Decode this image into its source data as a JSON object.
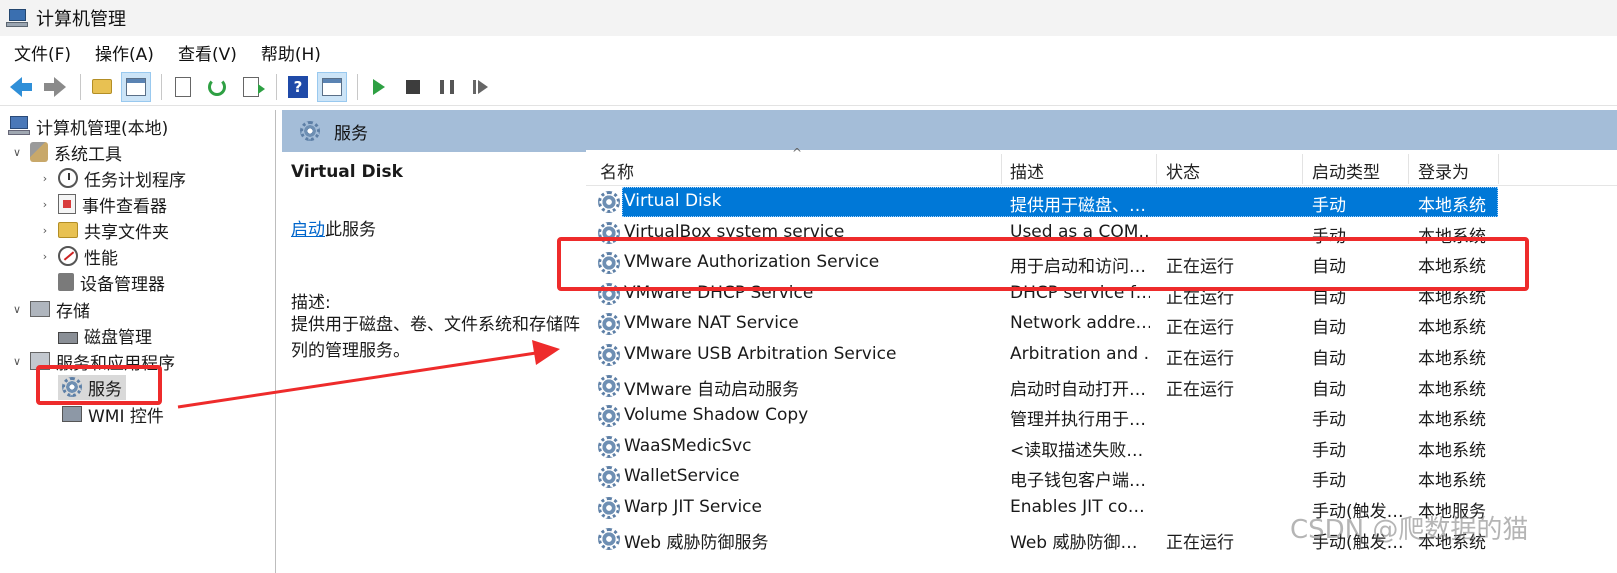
{
  "window": {
    "title": "计算机管理"
  },
  "menu": [
    "文件(F)",
    "操作(A)",
    "查看(V)",
    "帮助(H)"
  ],
  "toolbar_icons": [
    "back-icon",
    "forward-icon",
    "up-folder-icon",
    "show-hide-tree-icon",
    "properties-icon",
    "refresh-icon",
    "export-list-icon",
    "help-icon",
    "show-action-pane-icon",
    "start-service-icon",
    "stop-service-icon",
    "pause-service-icon",
    "restart-service-icon"
  ],
  "tree": {
    "root": "计算机管理(本地)",
    "system_tools": "系统工具",
    "task_scheduler": "任务计划程序",
    "event_viewer": "事件查看器",
    "shared_folders": "共享文件夹",
    "performance": "性能",
    "device_manager": "设备管理器",
    "storage": "存储",
    "disk_management": "磁盘管理",
    "services_apps": "服务和应用程序",
    "services": "服务",
    "wmi": "WMI 控件"
  },
  "content": {
    "header_title": "服务",
    "selected_name": "Virtual Disk",
    "action_link": "启动",
    "action_suffix": "此服务",
    "desc_label": "描述:",
    "desc_text": "提供用于磁盘、卷、文件系统和存储阵列的管理服务。"
  },
  "columns": {
    "name": "名称",
    "desc": "描述",
    "status": "状态",
    "startup": "启动类型",
    "logon": "登录为"
  },
  "services": [
    {
      "name": "Virtual Disk",
      "desc": "提供用于磁盘、…",
      "status": "",
      "startup": "手动",
      "logon": "本地系统"
    },
    {
      "name": "VirtualBox system service",
      "desc": "Used as a COM…",
      "status": "",
      "startup": "手动",
      "logon": "本地系统"
    },
    {
      "name": "VMware Authorization Service",
      "desc": "用于启动和访问…",
      "status": "正在运行",
      "startup": "自动",
      "logon": "本地系统"
    },
    {
      "name": "VMware DHCP Service",
      "desc": "DHCP service f…",
      "status": "正在运行",
      "startup": "自动",
      "logon": "本地系统"
    },
    {
      "name": "VMware NAT Service",
      "desc": "Network addre…",
      "status": "正在运行",
      "startup": "自动",
      "logon": "本地系统"
    },
    {
      "name": "VMware USB Arbitration Service",
      "desc": "Arbitration and …",
      "status": "正在运行",
      "startup": "自动",
      "logon": "本地系统"
    },
    {
      "name": "VMware 自动启动服务",
      "desc": "启动时自动打开…",
      "status": "正在运行",
      "startup": "自动",
      "logon": "本地系统"
    },
    {
      "name": "Volume Shadow Copy",
      "desc": "管理并执行用于…",
      "status": "",
      "startup": "手动",
      "logon": "本地系统"
    },
    {
      "name": "WaaSMedicSvc",
      "desc": "<读取描述失败…",
      "status": "",
      "startup": "手动",
      "logon": "本地系统"
    },
    {
      "name": "WalletService",
      "desc": "电子钱包客户端…",
      "status": "",
      "startup": "手动",
      "logon": "本地系统"
    },
    {
      "name": "Warp JIT Service",
      "desc": "Enables JIT co…",
      "status": "",
      "startup": "手动(触发…",
      "logon": "本地服务"
    },
    {
      "name": "Web 威胁防御服务",
      "desc": "Web 威胁防御…",
      "status": "正在运行",
      "startup": "手动(触发…",
      "logon": "本地系统"
    }
  ],
  "watermark": "CSDN @爬数据的猫",
  "colors": {
    "selection": "#0078d7",
    "header_band": "#a4bdd8",
    "annotation": "#ee2b2b",
    "link": "#0066cc"
  }
}
